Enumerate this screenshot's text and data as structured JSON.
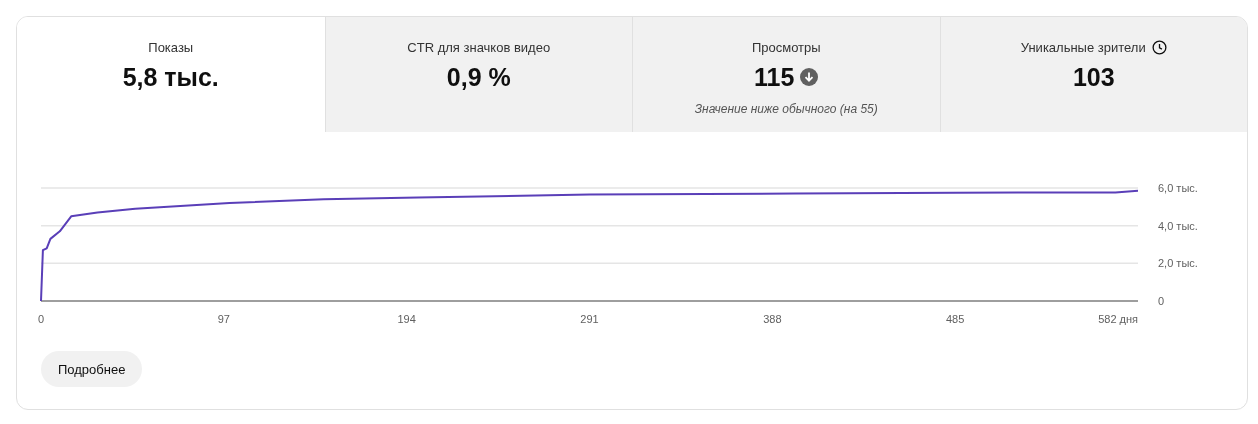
{
  "tabs": [
    {
      "label": "Показы",
      "value": "5,8 тыс.",
      "selected": true,
      "below_normal": false,
      "clock": false
    },
    {
      "label": "CTR для значков видео",
      "value": "0,9 %",
      "selected": false,
      "below_normal": false,
      "clock": false
    },
    {
      "label": "Просмотры",
      "value": "115",
      "note": "Значение ниже обычного (на 55)",
      "selected": false,
      "below_normal": true,
      "clock": false
    },
    {
      "label": "Уникальные зрители",
      "value": "103",
      "selected": false,
      "below_normal": false,
      "clock": true
    }
  ],
  "chart_data": {
    "type": "line",
    "x": [
      0,
      1,
      3,
      5,
      10,
      16,
      30,
      50,
      100,
      150,
      200,
      291,
      400,
      485,
      570,
      582
    ],
    "series": [
      {
        "color": "#5a3fb8",
        "values": [
          0,
          2.7,
          2.8,
          3.3,
          3.7,
          4.5,
          4.7,
          4.9,
          5.2,
          5.4,
          5.5,
          5.65,
          5.7,
          5.75,
          5.76,
          5.85
        ]
      }
    ],
    "xlim": [
      0,
      582
    ],
    "ylim": [
      0,
      6
    ],
    "xticks": [
      0,
      97,
      194,
      291,
      388,
      485,
      {
        "value": 582,
        "label": "582 дня"
      }
    ],
    "yticks": [
      {
        "value": 0,
        "label": "0"
      },
      {
        "value": 2,
        "label": "2,0 тыс."
      },
      {
        "value": 4,
        "label": "4,0 тыс."
      },
      {
        "value": 6,
        "label": "6,0 тыс."
      }
    ]
  },
  "button": {
    "label": "Подробнее"
  }
}
